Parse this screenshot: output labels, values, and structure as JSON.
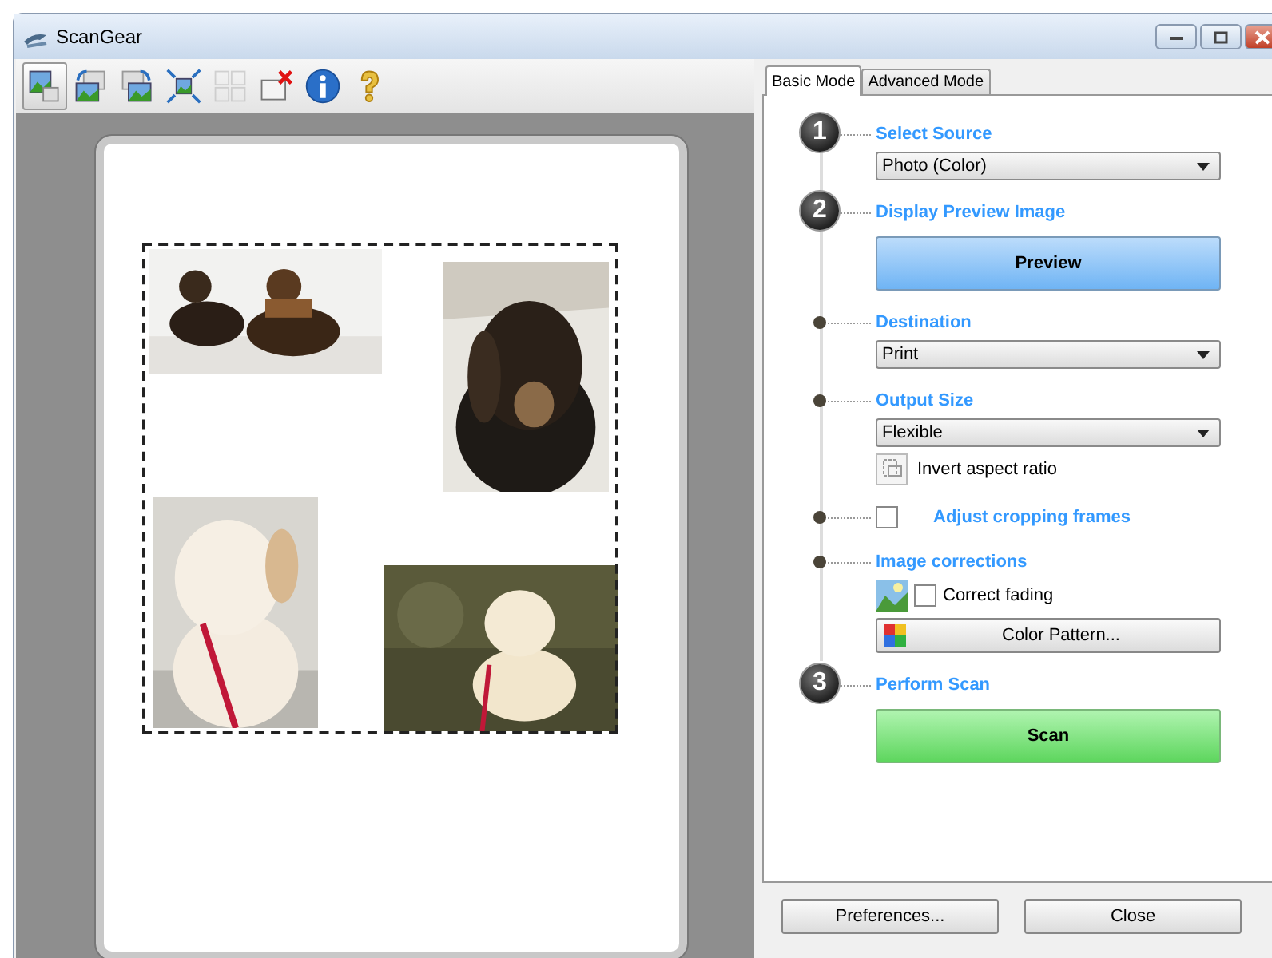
{
  "window": {
    "title": "ScanGear"
  },
  "toolbar": [
    {
      "kind": "thumbnail",
      "selected": true,
      "disabled": false
    },
    {
      "kind": "rotate-left",
      "selected": false,
      "disabled": false
    },
    {
      "kind": "rotate-right",
      "selected": false,
      "disabled": false
    },
    {
      "kind": "auto-crop",
      "selected": false,
      "disabled": false
    },
    {
      "kind": "multi-crop",
      "selected": false,
      "disabled": true
    },
    {
      "kind": "remove-crop",
      "selected": false,
      "disabled": false
    },
    {
      "kind": "info",
      "selected": false,
      "disabled": false
    },
    {
      "kind": "help",
      "selected": false,
      "disabled": false
    }
  ],
  "tabs": [
    {
      "label": "Basic Mode",
      "selected": true
    },
    {
      "label": "Advanced Mode",
      "selected": false
    }
  ],
  "steps": [
    {
      "kind": "number",
      "number": "1",
      "title": "Select Source",
      "controls": [
        {
          "kind": "dropdown",
          "value": "Photo (Color)"
        }
      ]
    },
    {
      "kind": "number",
      "number": "2",
      "title": "Display Preview Image",
      "controls": [
        {
          "kind": "preview-button",
          "label": "Preview"
        }
      ]
    },
    {
      "kind": "dot",
      "title": "Destination",
      "controls": [
        {
          "kind": "dropdown",
          "value": "Print"
        }
      ]
    },
    {
      "kind": "dot",
      "title": "Output Size",
      "controls": [
        {
          "kind": "dropdown",
          "value": "Flexible"
        },
        {
          "kind": "icon-label",
          "label": "Invert aspect ratio"
        }
      ]
    },
    {
      "kind": "dot",
      "controls": [
        {
          "kind": "heading-checkbox",
          "label": "Adjust cropping frames",
          "checked": false
        }
      ]
    },
    {
      "kind": "dot",
      "title": "Image corrections",
      "controls": [
        {
          "kind": "icon-checkbox",
          "label": "Correct fading",
          "checked": false
        },
        {
          "kind": "icon-button",
          "label": "Color Pattern..."
        }
      ]
    },
    {
      "kind": "number",
      "number": "3",
      "title": "Perform Scan",
      "controls": [
        {
          "kind": "scan-button",
          "label": "Scan"
        }
      ]
    }
  ],
  "footer_buttons": [
    "Preferences...",
    "Close"
  ]
}
